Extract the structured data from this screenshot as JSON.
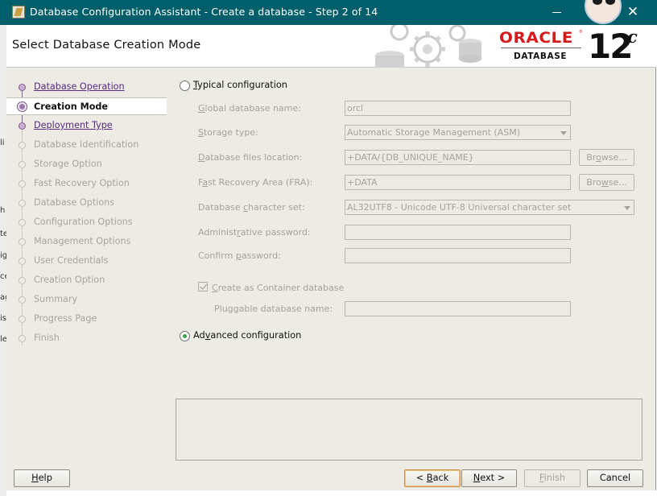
{
  "window": {
    "title": "Database Configuration Assistant - Create a database - Step 2 of 14",
    "close_glyph": "✕"
  },
  "header": {
    "page_title": "Select Database Creation Mode",
    "brand": "ORACLE",
    "registered": "®",
    "product": "DATABASE",
    "version": "12",
    "version_suffix": "c"
  },
  "steps": [
    {
      "label": "Database Operation",
      "state": "done"
    },
    {
      "label": "Creation Mode",
      "state": "current"
    },
    {
      "label": "Deployment Type",
      "state": "done"
    },
    {
      "label": "Database Identification",
      "state": "pending"
    },
    {
      "label": "Storage Option",
      "state": "pending"
    },
    {
      "label": "Fast Recovery Option",
      "state": "pending"
    },
    {
      "label": "Database Options",
      "state": "pending"
    },
    {
      "label": "Configuration Options",
      "state": "pending"
    },
    {
      "label": "Management Options",
      "state": "pending"
    },
    {
      "label": "User Credentials",
      "state": "pending"
    },
    {
      "label": "Creation Option",
      "state": "pending"
    },
    {
      "label": "Summary",
      "state": "pending"
    },
    {
      "label": "Progress Page",
      "state": "pending"
    },
    {
      "label": "Finish",
      "state": "pending"
    }
  ],
  "typical": {
    "mnemonic": "T",
    "label_rest": "ypical configuration",
    "selected": false,
    "global_db_name": {
      "label_pre": "",
      "mnemonic": "G",
      "label_post": "lobal database name:",
      "value": "orcl"
    },
    "storage_type": {
      "label_pre": "",
      "mnemonic": "S",
      "label_post": "torage type:",
      "value": "Automatic Storage Management (ASM)"
    },
    "db_files_location": {
      "label_pre": "",
      "mnemonic": "D",
      "label_post": "atabase files location:",
      "value": "+DATA/{DB_UNIQUE_NAME}"
    },
    "fra": {
      "label_pre": "F",
      "mnemonic": "a",
      "label_post": "st Recovery Area (FRA):",
      "value": "+DATA"
    },
    "charset": {
      "label_pre": "Database ",
      "mnemonic": "c",
      "label_post": "haracter set:",
      "value": "AL32UTF8 - Unicode UTF-8 Universal character set"
    },
    "admin_password": {
      "label_pre": "Administ",
      "mnemonic": "r",
      "label_post": "ative password:",
      "value": ""
    },
    "confirm_password": {
      "label_pre": "Confirm ",
      "mnemonic": "p",
      "label_post": "assword:",
      "value": ""
    },
    "browse_label": {
      "pre": "Br",
      "mnemonic": "o",
      "post": "wse..."
    },
    "browse2_label": {
      "pre": "Bro",
      "mnemonic": "w",
      "post": "se..."
    },
    "container": {
      "label_pre": "",
      "mnemonic": "C",
      "label_post": "reate as Container database",
      "checked": true
    },
    "pdb_name": {
      "label": "Pluggable database name:",
      "value": ""
    }
  },
  "advanced": {
    "label_pre": "Ad",
    "mnemonic": "v",
    "label_post": "anced configuration",
    "selected": true
  },
  "buttons": {
    "help": {
      "mnemonic": "H",
      "rest": "elp"
    },
    "back": {
      "pre": "< ",
      "mnemonic": "B",
      "rest": "ack"
    },
    "next": {
      "pre": "",
      "mnemonic": "N",
      "rest": "ext >"
    },
    "finish": {
      "pre": "",
      "mnemonic": "F",
      "rest": "inish"
    },
    "cancel": {
      "label": "Cancel"
    }
  },
  "desktop_fragments": [
    "li",
    "h",
    "te",
    "ig",
    "ce",
    "ag",
    "is",
    "le"
  ]
}
